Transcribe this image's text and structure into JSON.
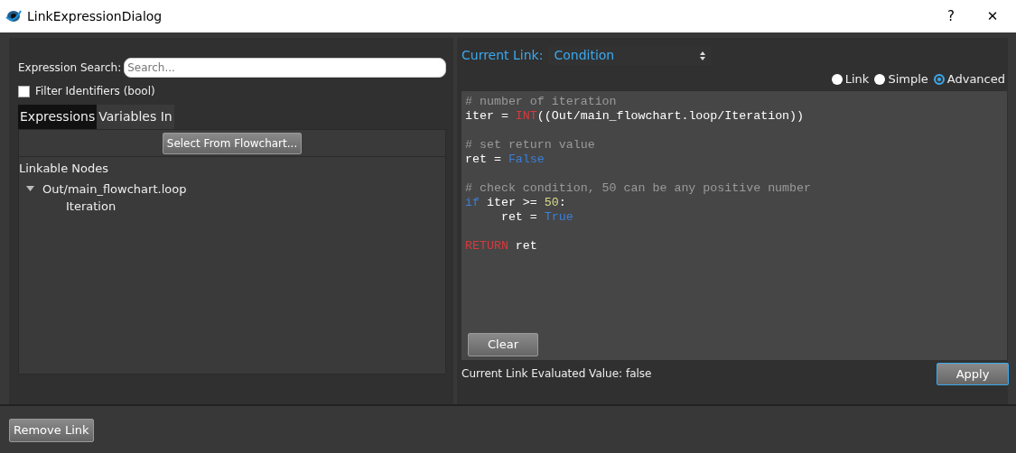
{
  "window": {
    "title": "LinkExpressionDialog",
    "help": "?",
    "close": "✕"
  },
  "left": {
    "search_label": "Expression Search:",
    "search": {
      "placeholder": "Search..."
    },
    "filter": {
      "label": "Filter Identifiers  (bool)",
      "checked": false
    },
    "tabs": [
      {
        "label": "Expressions",
        "selected": true
      },
      {
        "label": "Variables In",
        "selected": false
      }
    ],
    "select_button": "Select From Flowchart...",
    "tree": {
      "heading": "Linkable Nodes",
      "items": [
        {
          "label": "Out/main_flowchart.loop",
          "expanded": true,
          "children": [
            {
              "label": "Iteration"
            }
          ]
        }
      ]
    }
  },
  "right": {
    "current_link_label": "Current Link:",
    "current_link": "Condition",
    "modes": [
      {
        "label": "Link",
        "selected": false
      },
      {
        "label": "Simple",
        "selected": false
      },
      {
        "label": "Advanced",
        "selected": true
      }
    ],
    "code_lines": [
      {
        "kind": "code",
        "tokens": [
          {
            "kind": "comment",
            "text": "# number of iteration"
          }
        ]
      },
      {
        "kind": "code",
        "tokens": [
          {
            "kind": "plain",
            "text": "iter = "
          },
          {
            "kind": "builtin",
            "text": "INT"
          },
          {
            "kind": "plain",
            "text": "((Out/main_flowchart.loop/Iteration))"
          }
        ]
      },
      {
        "kind": "blank"
      },
      {
        "kind": "code",
        "tokens": [
          {
            "kind": "comment",
            "text": "# set return value"
          }
        ]
      },
      {
        "kind": "code",
        "tokens": [
          {
            "kind": "plain",
            "text": "ret = "
          },
          {
            "kind": "keyword",
            "text": "False"
          }
        ]
      },
      {
        "kind": "blank"
      },
      {
        "kind": "code",
        "tokens": [
          {
            "kind": "comment",
            "text": "# check condition, 50 can be any positive number"
          }
        ]
      },
      {
        "kind": "code",
        "tokens": [
          {
            "kind": "keyword",
            "text": "if"
          },
          {
            "kind": "plain",
            "text": " iter >= "
          },
          {
            "kind": "number",
            "text": "50"
          },
          {
            "kind": "plain",
            "text": ":"
          }
        ]
      },
      {
        "kind": "code",
        "tokens": [
          {
            "kind": "plain",
            "text": "     ret = "
          },
          {
            "kind": "keyword",
            "text": "True"
          }
        ]
      },
      {
        "kind": "blank"
      },
      {
        "kind": "code",
        "tokens": [
          {
            "kind": "builtin",
            "text": "RETURN"
          },
          {
            "kind": "plain",
            "text": " ret"
          }
        ]
      }
    ],
    "clear_button": "Clear",
    "evaluated": "Current Link Evaluated Value: false",
    "apply_button": "Apply"
  },
  "remove_button": "Remove Link"
}
